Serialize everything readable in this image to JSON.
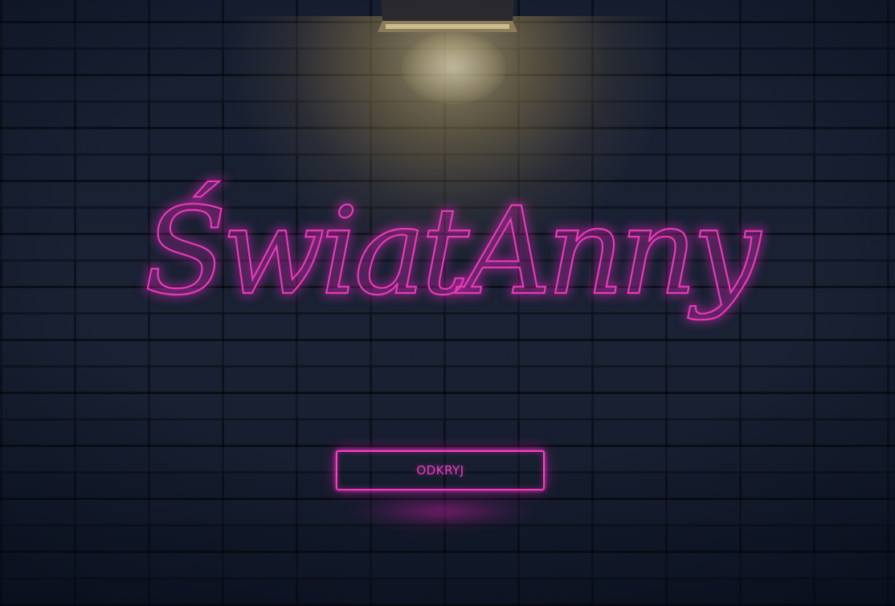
{
  "hero": {
    "title": "ŚwiatAnny",
    "button_label": "ODKRYJ"
  },
  "colors": {
    "neon": "#e63ab8",
    "background": "#121a2b",
    "light": "#f0d78c"
  },
  "icons": {
    "lamp": "wall-lamp-icon"
  }
}
